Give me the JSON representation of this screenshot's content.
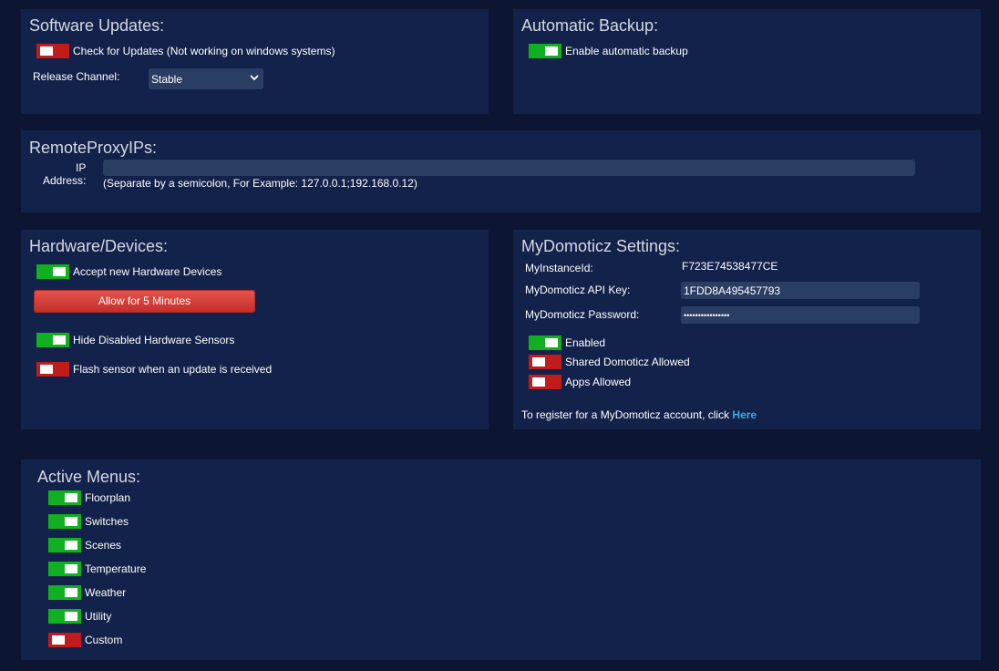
{
  "software_updates": {
    "title": "Software Updates:",
    "check_label": "Check for Updates (Not working on windows systems)",
    "check_state": "off",
    "channel_label": "Release Channel:",
    "channel_value": "Stable"
  },
  "automatic_backup": {
    "title": "Automatic Backup:",
    "enable_label": "Enable automatic backup",
    "enable_state": "on"
  },
  "remote_proxy": {
    "title": "RemoteProxyIPs:",
    "ip_label_line1": "IP",
    "ip_label_line2": "Address:",
    "ip_value": "",
    "hint": "(Separate by a semicolon, For Example: 127.0.0.1;192.168.0.12)"
  },
  "hardware_devices": {
    "title": "Hardware/Devices:",
    "accept_label": "Accept new Hardware Devices",
    "accept_state": "on",
    "allow_button": "Allow for 5 Minutes",
    "hide_label": "Hide Disabled Hardware Sensors",
    "hide_state": "on",
    "flash_label": "Flash sensor when an update is received",
    "flash_state": "off"
  },
  "mydomoticz": {
    "title": "MyDomoticz Settings:",
    "instance_label": "MyInstanceId:",
    "instance_value": "F723E74538477CE",
    "api_key_label": "MyDomoticz API Key:",
    "api_key_value": "1FDD8A495457793",
    "password_label": "MyDomoticz Password:",
    "password_value": "••••••••••••••••",
    "enabled_label": "Enabled",
    "enabled_state": "on",
    "shared_label": "Shared Domoticz Allowed",
    "shared_state": "off",
    "apps_label": "Apps Allowed",
    "apps_state": "off",
    "register_text": "To register for a MyDomoticz account, click",
    "register_link": "Here"
  },
  "active_menus": {
    "title": "Active Menus:",
    "items": [
      {
        "label": "Floorplan",
        "state": "on"
      },
      {
        "label": "Switches",
        "state": "on"
      },
      {
        "label": "Scenes",
        "state": "on"
      },
      {
        "label": "Temperature",
        "state": "on"
      },
      {
        "label": "Weather",
        "state": "on"
      },
      {
        "label": "Utility",
        "state": "on"
      },
      {
        "label": "Custom",
        "state": "off"
      }
    ]
  },
  "colors": {
    "toggle_on": "#11b021",
    "toggle_off": "#c21b1b",
    "panel": "#13224a",
    "background": "#0c1632",
    "link": "#43a6e4"
  }
}
